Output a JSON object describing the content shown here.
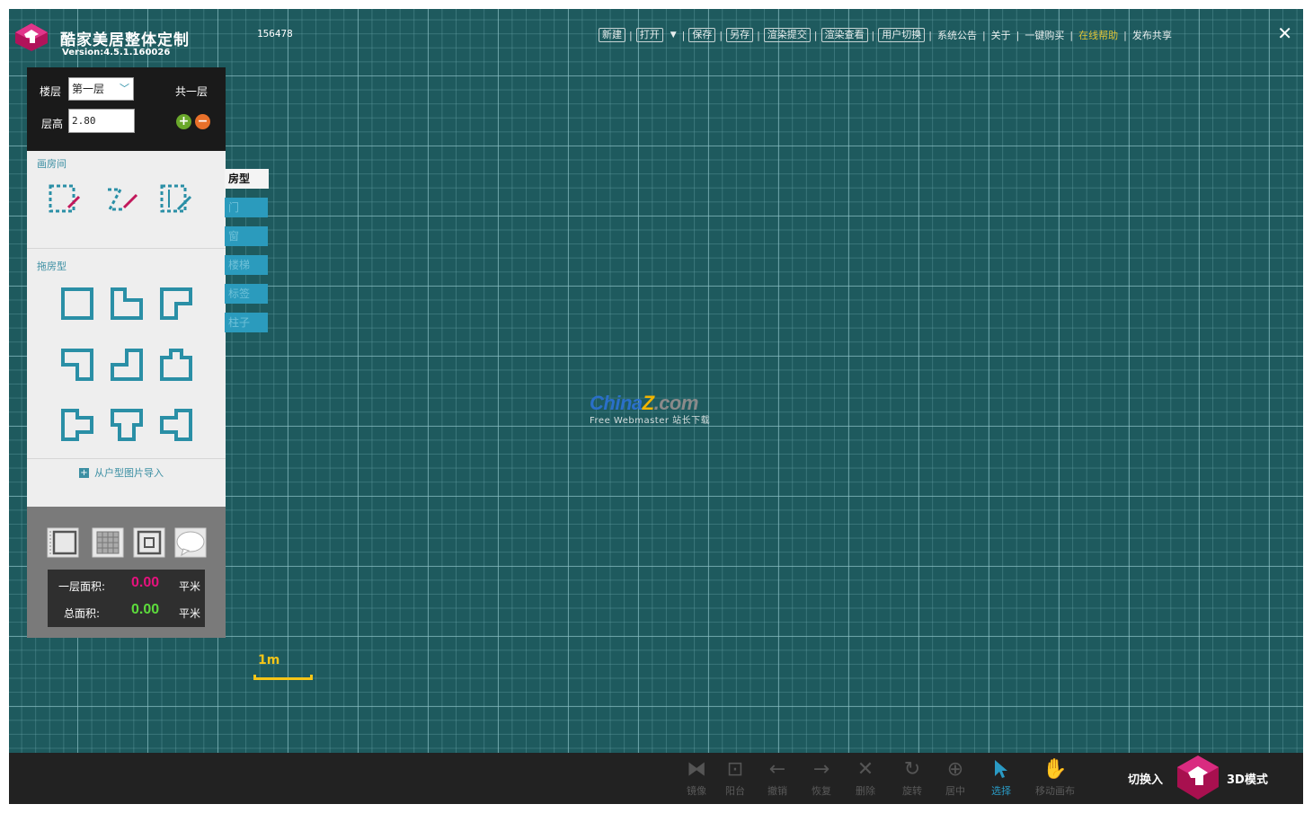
{
  "app": {
    "title": "酷家美居整体定制",
    "version": "Version:4.5.1.160026",
    "counter": "156478"
  },
  "menu": [
    {
      "label": "新建",
      "boxed": true
    },
    {
      "label": "打开",
      "boxed": true,
      "dropdown": true
    },
    {
      "label": "保存",
      "boxed": true
    },
    {
      "label": "另存",
      "boxed": true
    },
    {
      "label": "渲染提交",
      "boxed": true
    },
    {
      "label": "渲染查看",
      "boxed": true
    },
    {
      "label": "用户切换",
      "boxed": true
    },
    {
      "label": "系统公告"
    },
    {
      "label": "关于"
    },
    {
      "label": "一键购买"
    },
    {
      "label": "在线帮助",
      "highlight": true
    },
    {
      "label": "发布共享"
    }
  ],
  "floor": {
    "floor_label": "楼层",
    "floor_value": "第一层",
    "total_label": "共一层",
    "height_label": "层高",
    "height_value": "2.80"
  },
  "tools": {
    "draw_section": "画房间",
    "drag_section": "拖房型",
    "import_label": "从户型图片导入"
  },
  "tabs": [
    "房型",
    "门",
    "窗",
    "楼梯",
    "标签",
    "柱子"
  ],
  "area": {
    "floor_area_label": "一层面积:",
    "floor_area_value": "0.00",
    "total_area_label": "总面积:",
    "total_area_value": "0.00",
    "unit": "平米"
  },
  "scale": {
    "label": "1m"
  },
  "watermark": {
    "china": "China",
    "z": "Z",
    "domain": ".com",
    "sub": "Free Webmaster  站长下载"
  },
  "toolbar": [
    {
      "label": "镜像",
      "icon": "mirror-icon"
    },
    {
      "label": "阳台",
      "icon": "balcony-icon"
    },
    {
      "label": "撤销",
      "icon": "undo-icon"
    },
    {
      "label": "恢复",
      "icon": "redo-icon"
    },
    {
      "label": "删除",
      "icon": "delete-icon"
    },
    {
      "label": "旋转",
      "icon": "rotate-icon"
    },
    {
      "label": "居中",
      "icon": "center-icon"
    },
    {
      "label": "选择",
      "icon": "select-cursor-icon",
      "active": true
    },
    {
      "label": "移动画布",
      "icon": "hand-icon"
    }
  ],
  "switch": {
    "prefix": "切换入",
    "suffix": "3D模式"
  },
  "colors": {
    "canvas": "#1e5a5e",
    "accent": "#2b9bbd",
    "floor_area_value": "#e5127d",
    "total_area_value": "#5ddc3c",
    "scale": "#f5c518",
    "logo": "#c2185b"
  }
}
